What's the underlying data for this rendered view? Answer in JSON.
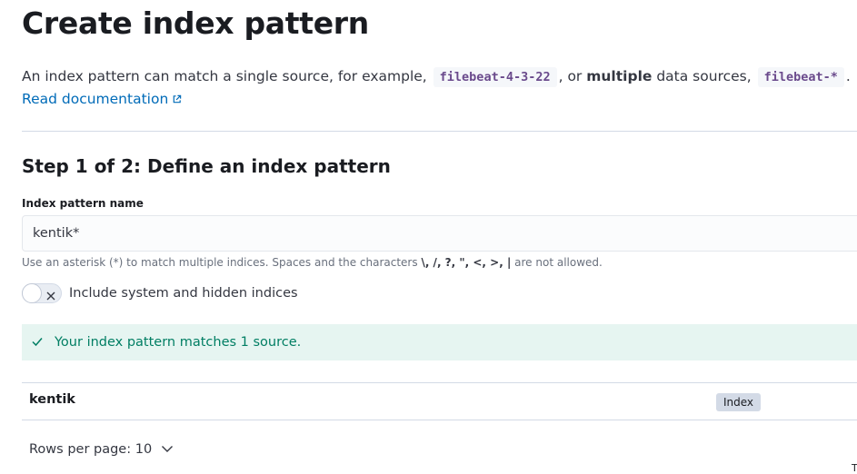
{
  "header": {
    "title": "Create index pattern",
    "description": {
      "part1": "An index pattern can match a single source, for example,",
      "example_single": "filebeat-4-3-22",
      "part2": ", or",
      "emphasis": "multiple",
      "part3": "data sources,",
      "example_multiple": "filebeat-*",
      "part4": "."
    },
    "doc_link_label": "Read documentation",
    "doc_link_icon": "external-link-icon"
  },
  "step": {
    "title": "Step 1 of 2: Define an index pattern",
    "field_label": "Index pattern name",
    "field_value": "kentik*",
    "help_text": {
      "prefix": "Use an asterisk (*) to match multiple indices. Spaces and the characters",
      "chars": "\\, /, ?, \", <, >, |",
      "suffix": "are not allowed."
    },
    "toggle": {
      "label": "Include system and hidden indices",
      "checked": false,
      "icon": "cross-icon"
    },
    "callout": {
      "icon": "check-icon",
      "text": "Your index pattern matches 1 source.",
      "color": "#007e63"
    }
  },
  "results": {
    "rows": [
      {
        "name": "kentik",
        "type": "Index"
      }
    ],
    "pagination": {
      "label": "Rows per page: 10",
      "icon": "chevron-down-icon"
    }
  },
  "edge_glyph": "T",
  "colors": {
    "link": "#006bb8",
    "code": "#6a4a8c",
    "success_bg": "#e6f5f1"
  }
}
